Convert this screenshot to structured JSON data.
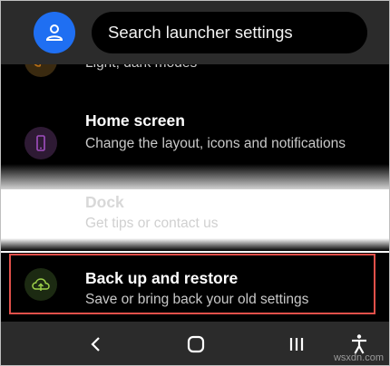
{
  "header": {
    "search_label": "Search launcher settings"
  },
  "settings": {
    "items": [
      {
        "title": "",
        "subtitle": "Light, dark modes",
        "icon": "palette-icon",
        "icon_color": "#b86f17"
      },
      {
        "title": "Home screen",
        "subtitle": "Change the layout, icons and notifications",
        "icon": "phone-icon",
        "icon_color": "#a04ec0"
      },
      {
        "title": "Dock",
        "subtitle": "Get tips or contact us",
        "icon": "dock-icon"
      },
      {
        "title": "Back up and restore",
        "subtitle": "Save or bring back your old settings",
        "icon": "cloud-upload-icon",
        "icon_color": "#9dd14a"
      }
    ]
  },
  "navbar": {
    "back_icon": "back-icon",
    "home_icon": "home-icon",
    "recents_icon": "recents-icon",
    "accessibility_icon": "accessibility-icon"
  },
  "watermark": "wsxdn.com",
  "colors": {
    "accent_blue": "#1f6ff2",
    "highlight_red": "#e0504a"
  }
}
